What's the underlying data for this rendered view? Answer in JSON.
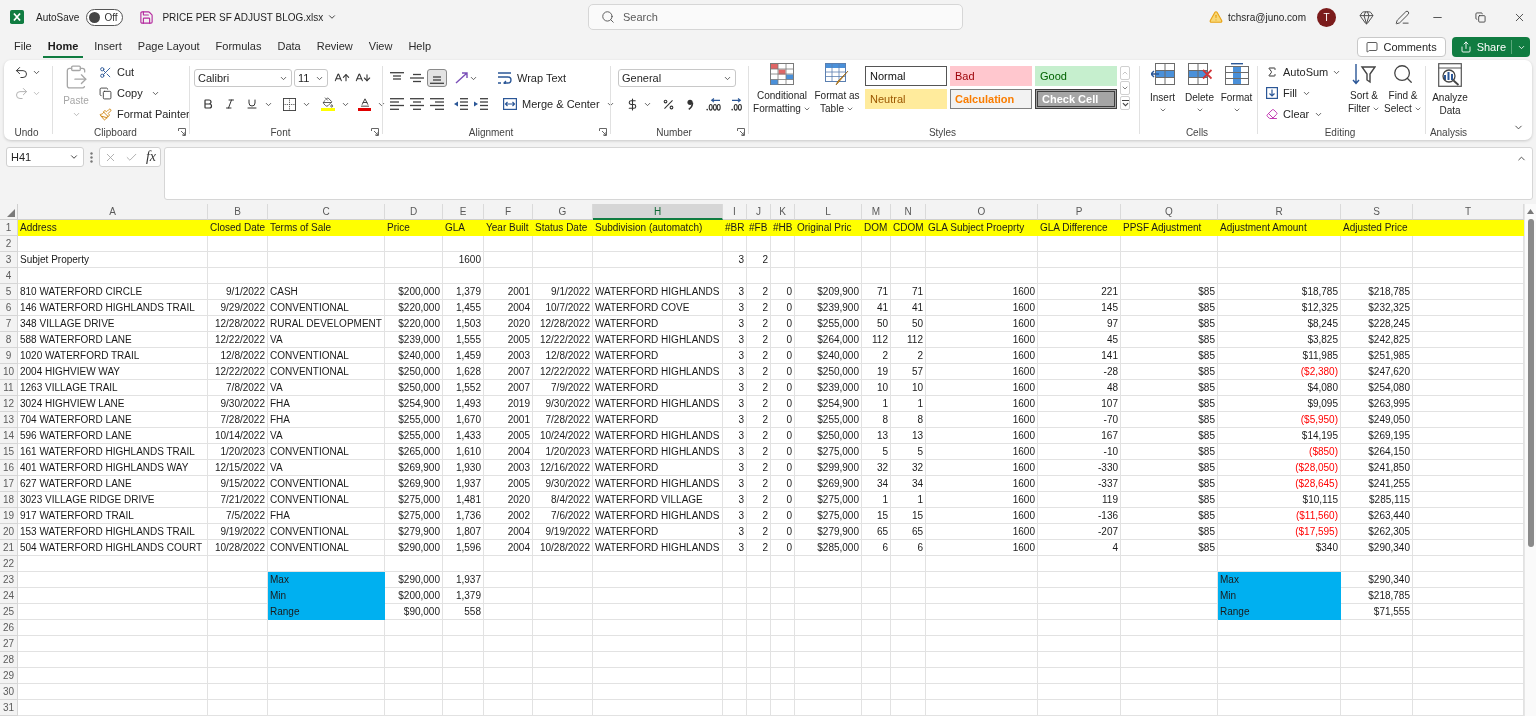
{
  "title_bar": {
    "autosave_label": "AutoSave",
    "autosave_toggle": {
      "on": false,
      "label": "Off"
    },
    "file_name": "PRICE PER SF ADJUST BLOG.xlsx",
    "search": {
      "placeholder": "Search"
    },
    "account_email": "tchsra@juno.com",
    "avatar_initial": "T"
  },
  "menu_tabs": [
    {
      "label": "File",
      "selected": false
    },
    {
      "label": "Home",
      "selected": true
    },
    {
      "label": "Insert",
      "selected": false
    },
    {
      "label": "Page Layout",
      "selected": false
    },
    {
      "label": "Formulas",
      "selected": false
    },
    {
      "label": "Data",
      "selected": false
    },
    {
      "label": "Review",
      "selected": false
    },
    {
      "label": "View",
      "selected": false
    },
    {
      "label": "Help",
      "selected": false
    }
  ],
  "header_buttons": {
    "comments": "Comments",
    "share": "Share"
  },
  "ribbon": {
    "undo": {
      "label": "Undo",
      "buttons": [
        {
          "kind": "undo",
          "disabled": false
        },
        {
          "kind": "redo",
          "disabled": true
        }
      ]
    },
    "clipboard": {
      "label": "Clipboard",
      "paste": {
        "label": "Paste",
        "disabled": true
      },
      "cut": "Cut",
      "copy": "Copy",
      "format_painter": "Format Painter"
    },
    "font": {
      "label": "Font",
      "font_name": "Calibri",
      "font_size": "11"
    },
    "alignment": {
      "label": "Alignment",
      "vertical_align": [
        {
          "kind": "top",
          "selected": false
        },
        {
          "kind": "middle",
          "selected": false
        },
        {
          "kind": "bottom",
          "selected": true
        }
      ],
      "wrap_text": "Wrap Text",
      "merge_center": "Merge & Center"
    },
    "number": {
      "label": "Number",
      "format": "General"
    },
    "styles": {
      "label": "Styles",
      "conditional_formatting": [
        "Conditional",
        "Formatting"
      ],
      "format_as_table": [
        "Format as",
        "Table"
      ],
      "gallery": [
        {
          "kind": "normal",
          "label": "Normal"
        },
        {
          "kind": "bad",
          "label": "Bad"
        },
        {
          "kind": "good",
          "label": "Good"
        },
        {
          "kind": "neutral",
          "label": "Neutral"
        },
        {
          "kind": "calculation",
          "label": "Calculation"
        },
        {
          "kind": "check",
          "label": "Check Cell"
        }
      ]
    },
    "cells": {
      "label": "Cells",
      "buttons": [
        {
          "kind": "insert",
          "label": "Insert"
        },
        {
          "kind": "delete",
          "label": "Delete"
        },
        {
          "kind": "format",
          "label": "Format"
        }
      ]
    },
    "editing": {
      "label": "Editing",
      "autosum": "AutoSum",
      "fill": "Fill",
      "clear": "Clear",
      "sort_filter": [
        "Sort &",
        "Filter"
      ],
      "find_select": [
        "Find &",
        "Select"
      ]
    },
    "analysis": {
      "label": "Analysis",
      "analyze_data": [
        "Analyze",
        "Data"
      ]
    }
  },
  "formula_bar": {
    "name_box": "H41",
    "function_label": "fx"
  },
  "sheet": {
    "columns": [
      {
        "label": "A",
        "selected": false
      },
      {
        "label": "B",
        "selected": false
      },
      {
        "label": "C",
        "selected": false
      },
      {
        "label": "D",
        "selected": false
      },
      {
        "label": "E",
        "selected": false
      },
      {
        "label": "F",
        "selected": false
      },
      {
        "label": "G",
        "selected": false
      },
      {
        "label": "H",
        "selected": true
      },
      {
        "label": "I",
        "selected": false
      },
      {
        "label": "J",
        "selected": false
      },
      {
        "label": "K",
        "selected": false
      },
      {
        "label": "L",
        "selected": false
      },
      {
        "label": "M",
        "selected": false
      },
      {
        "label": "N",
        "selected": false
      },
      {
        "label": "O",
        "selected": false
      },
      {
        "label": "P",
        "selected": false
      },
      {
        "label": "Q",
        "selected": false
      },
      {
        "label": "R",
        "selected": false
      },
      {
        "label": "S",
        "selected": false
      },
      {
        "label": "T",
        "selected": false
      }
    ],
    "rows": [
      {
        "number": "1",
        "kind": "header",
        "color": "#ffff00",
        "values": [
          "Address",
          "Closed Date",
          "Terms of Sale",
          "Price",
          "GLA",
          "Year Built",
          "Status Date",
          "Subdivision (automatch)",
          "#BR",
          "#FB",
          "#HB",
          "Original Pric",
          "DOM",
          "CDOM",
          "GLA Subject Proeprty",
          "GLA Difference",
          "PPSF Adjustment",
          "Adjustment Amount",
          "Adjusted Price"
        ]
      },
      {
        "number": "2",
        "kind": "blank"
      },
      {
        "number": "3",
        "kind": "partial",
        "cells": {
          "address": "Subjet Property",
          "gla": "1600",
          "br": "3",
          "fb": "2"
        }
      },
      {
        "number": "4",
        "kind": "blank"
      },
      {
        "number": "5",
        "kind": "record",
        "values": [
          "810 WATERFORD CIRCLE",
          "9/1/2022",
          "CASH",
          "$200,000",
          "1,379",
          "2001",
          "9/1/2022",
          "WATERFORD HIGHLANDS",
          "3",
          "2",
          "0",
          "$209,900",
          "71",
          "71",
          "1600",
          "221",
          "$85",
          "$18,785",
          "$218,785"
        ]
      },
      {
        "number": "6",
        "kind": "record",
        "values": [
          "146 WATERFORD HIGHLANDS TRAIL",
          "9/29/2022",
          "CONVENTIONAL",
          "$220,000",
          "1,455",
          "2004",
          "10/7/2022",
          "WATERFORD COVE",
          "3",
          "2",
          "0",
          "$239,900",
          "41",
          "41",
          "1600",
          "145",
          "$85",
          "$12,325",
          "$232,325"
        ]
      },
      {
        "number": "7",
        "kind": "record",
        "values": [
          "348 VILLAGE DRIVE",
          "12/28/2022",
          "RURAL DEVELOPMENT",
          "$220,000",
          "1,503",
          "2020",
          "12/28/2022",
          "WATERFORD",
          "3",
          "2",
          "0",
          "$255,000",
          "50",
          "50",
          "1600",
          "97",
          "$85",
          "$8,245",
          "$228,245"
        ]
      },
      {
        "number": "8",
        "kind": "record",
        "values": [
          "588 WATERFORD LANE",
          "12/22/2022",
          "VA",
          "$239,000",
          "1,555",
          "2005",
          "12/22/2022",
          "WATERFORD HIGHLANDS",
          "3",
          "2",
          "0",
          "$264,000",
          "112",
          "112",
          "1600",
          "45",
          "$85",
          "$3,825",
          "$242,825"
        ]
      },
      {
        "number": "9",
        "kind": "record",
        "values": [
          "1020 WATERFORD TRAIL",
          "12/8/2022",
          "CONVENTIONAL",
          "$240,000",
          "1,459",
          "2003",
          "12/8/2022",
          "WATERFORD",
          "3",
          "2",
          "0",
          "$240,000",
          "2",
          "2",
          "1600",
          "141",
          "$85",
          "$11,985",
          "$251,985"
        ]
      },
      {
        "number": "10",
        "kind": "record",
        "values": [
          "2004 HIGHVIEW WAY",
          "12/22/2022",
          "CONVENTIONAL",
          "$250,000",
          "1,628",
          "2007",
          "12/22/2022",
          "WATERFORD HIGHLANDS",
          "3",
          "2",
          "0",
          "$250,000",
          "19",
          "57",
          "1600",
          "-28",
          "$85",
          {
            "text": "($2,380)",
            "negative": true
          },
          "$247,620"
        ]
      },
      {
        "number": "11",
        "kind": "record",
        "values": [
          "1263 VILLAGE TRAIL",
          "7/8/2022",
          "VA",
          "$250,000",
          "1,552",
          "2007",
          "7/9/2022",
          "WATERFORD",
          "3",
          "2",
          "0",
          "$239,000",
          "10",
          "10",
          "1600",
          "48",
          "$85",
          "$4,080",
          "$254,080"
        ]
      },
      {
        "number": "12",
        "kind": "record",
        "values": [
          "3024 HIGHVIEW LANE",
          "9/30/2022",
          "FHA",
          "$254,900",
          "1,493",
          "2019",
          "9/30/2022",
          "WATERFORD HIGHLANDS",
          "3",
          "2",
          "0",
          "$254,900",
          "1",
          "1",
          "1600",
          "107",
          "$85",
          "$9,095",
          "$263,995"
        ]
      },
      {
        "number": "13",
        "kind": "record",
        "values": [
          "704 WATERFORD LANE",
          "7/28/2022",
          "FHA",
          "$255,000",
          "1,670",
          "2001",
          "7/28/2022",
          "WATERFORD",
          "3",
          "2",
          "0",
          "$255,000",
          "8",
          "8",
          "1600",
          "-70",
          "$85",
          {
            "text": "($5,950)",
            "negative": true
          },
          "$249,050"
        ]
      },
      {
        "number": "14",
        "kind": "record",
        "values": [
          "596 WATERFORD LANE",
          "10/14/2022",
          "VA",
          "$255,000",
          "1,433",
          "2005",
          "10/24/2022",
          "WATERFORD HIGHLANDS",
          "3",
          "2",
          "0",
          "$250,000",
          "13",
          "13",
          "1600",
          "167",
          "$85",
          "$14,195",
          "$269,195"
        ]
      },
      {
        "number": "15",
        "kind": "record",
        "values": [
          "161 WATERFORD HIGHLANDS TRAIL",
          "1/20/2023",
          "CONVENTIONAL",
          "$265,000",
          "1,610",
          "2004",
          "1/20/2023",
          "WATERFORD HIGHLANDS",
          "3",
          "2",
          "0",
          "$275,000",
          "5",
          "5",
          "1600",
          "-10",
          "$85",
          {
            "text": "($850)",
            "negative": true
          },
          "$264,150"
        ]
      },
      {
        "number": "16",
        "kind": "record",
        "values": [
          "401 WATERFORD HIGHLANDS WAY",
          "12/15/2022",
          "VA",
          "$269,900",
          "1,930",
          "2003",
          "12/16/2022",
          "WATERFORD",
          "3",
          "2",
          "0",
          "$299,900",
          "32",
          "32",
          "1600",
          "-330",
          "$85",
          {
            "text": "($28,050)",
            "negative": true
          },
          "$241,850"
        ]
      },
      {
        "number": "17",
        "kind": "record",
        "values": [
          "627 WATERFORD LANE",
          "9/15/2022",
          "CONVENTIONAL",
          "$269,900",
          "1,937",
          "2005",
          "9/30/2022",
          "WATERFORD HIGHLANDS",
          "3",
          "2",
          "0",
          "$269,900",
          "34",
          "34",
          "1600",
          "-337",
          "$85",
          {
            "text": "($28,645)",
            "negative": true
          },
          "$241,255"
        ]
      },
      {
        "number": "18",
        "kind": "record",
        "values": [
          "3023 VILLAGE RIDGE DRIVE",
          "7/21/2022",
          "CONVENTIONAL",
          "$275,000",
          "1,481",
          "2020",
          "8/4/2022",
          "WATERFORD VILLAGE",
          "3",
          "2",
          "0",
          "$275,000",
          "1",
          "1",
          "1600",
          "119",
          "$85",
          "$10,115",
          "$285,115"
        ]
      },
      {
        "number": "19",
        "kind": "record",
        "values": [
          "917 WATERFORD TRAIL",
          "7/5/2022",
          "FHA",
          "$275,000",
          "1,736",
          "2002",
          "7/6/2022",
          "WATERFORD HIGHLANDS",
          "3",
          "2",
          "0",
          "$275,000",
          "15",
          "15",
          "1600",
          "-136",
          "$85",
          {
            "text": "($11,560)",
            "negative": true
          },
          "$263,440"
        ]
      },
      {
        "number": "20",
        "kind": "record",
        "values": [
          "153 WATERFORD HIGHLANDS TRAIL",
          "9/19/2022",
          "CONVENTIONAL",
          "$279,900",
          "1,807",
          "2004",
          "9/19/2022",
          "WATERFORD",
          "3",
          "2",
          "0",
          "$279,900",
          "65",
          "65",
          "1600",
          "-207",
          "$85",
          {
            "text": "($17,595)",
            "negative": true
          },
          "$262,305"
        ]
      },
      {
        "number": "21",
        "kind": "record",
        "values": [
          "504 WATERFORD HIGHLANDS COURT",
          "10/28/2022",
          "CONVENTIONAL",
          "$290,000",
          "1,596",
          "2004",
          "10/28/2022",
          "WATERFORD HIGHLANDS",
          "3",
          "2",
          "0",
          "$285,000",
          "6",
          "6",
          "1600",
          "4",
          "$85",
          "$340",
          "$290,340"
        ]
      },
      {
        "number": "22",
        "kind": "blank"
      },
      {
        "number": "23",
        "kind": "partial",
        "cells": {
          "terms_of_sale": {
            "text": "Max",
            "color": "#00b0f0"
          },
          "price": "$290,000",
          "gla": "1,937",
          "adjustment_amount": {
            "text": "Max",
            "color": "#00b0f0"
          },
          "adjusted_price": "$290,340"
        }
      },
      {
        "number": "24",
        "kind": "partial",
        "cells": {
          "terms_of_sale": {
            "text": "Min",
            "color": "#00b0f0"
          },
          "price": "$200,000",
          "gla": "1,379",
          "adjustment_amount": {
            "text": "Min",
            "color": "#00b0f0"
          },
          "adjusted_price": "$218,785"
        }
      },
      {
        "number": "25",
        "kind": "partial",
        "cells": {
          "terms_of_sale": {
            "text": "Range",
            "color": "#00b0f0"
          },
          "price": "$90,000",
          "gla": "558",
          "adjustment_amount": {
            "text": "Range",
            "color": "#00b0f0"
          },
          "adjusted_price": "$71,555"
        }
      },
      {
        "number": "26",
        "kind": "blank"
      },
      {
        "number": "27",
        "kind": "blank"
      },
      {
        "number": "28",
        "kind": "blank"
      },
      {
        "number": "29",
        "kind": "blank"
      },
      {
        "number": "30",
        "kind": "blank"
      },
      {
        "number": "31",
        "kind": "blank"
      }
    ]
  }
}
